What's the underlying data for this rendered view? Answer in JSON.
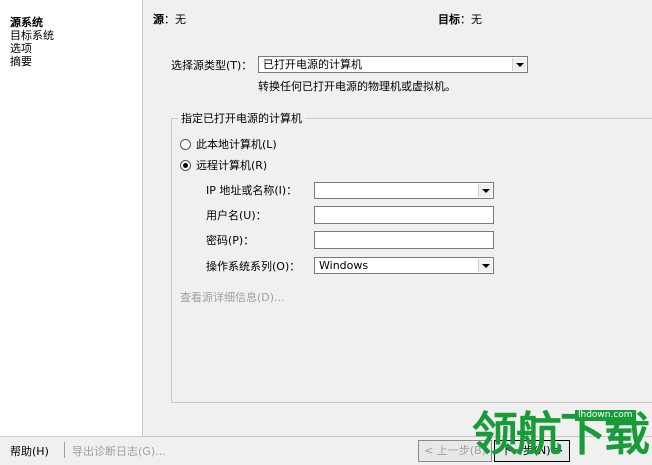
{
  "nav": {
    "items": [
      {
        "label": "源系统",
        "active": true
      },
      {
        "label": "目标系统",
        "active": false
      },
      {
        "label": "选项",
        "active": false
      },
      {
        "label": "摘要",
        "active": false
      }
    ]
  },
  "header": {
    "source_label": "源",
    "source_value": "：无",
    "target_label": "目标",
    "target_value": "：无"
  },
  "form": {
    "source_type_label": "选择源类型(T)：",
    "source_type_value": "已打开电源的计算机",
    "source_type_desc": "转换任何已打开电源的物理机或虚拟机。",
    "group_title": "指定已打开电源的计算机",
    "radio_local": "此本地计算机(L)",
    "radio_remote": "远程计算机(R)",
    "ip_label": "IP 地址或名称(I)：",
    "ip_value": "",
    "username_label": "用户名(U)：",
    "password_label": "密码(P)：",
    "os_label": "操作系统系列(O)：",
    "os_value": "Windows",
    "details_link": "查看源详细信息(D)..."
  },
  "footer": {
    "help": "帮助(H)",
    "export": "导出诊断日志(G)...",
    "prev": "< 上一步(B)",
    "next": "下一步(N) >"
  },
  "watermark": {
    "text": "领航下载",
    "url": "lhdown.com"
  },
  "colors": {
    "watermark_green": "#1a9b3a",
    "window_bg": "#f0f0f0",
    "disabled_text": "#a0a0a0"
  }
}
